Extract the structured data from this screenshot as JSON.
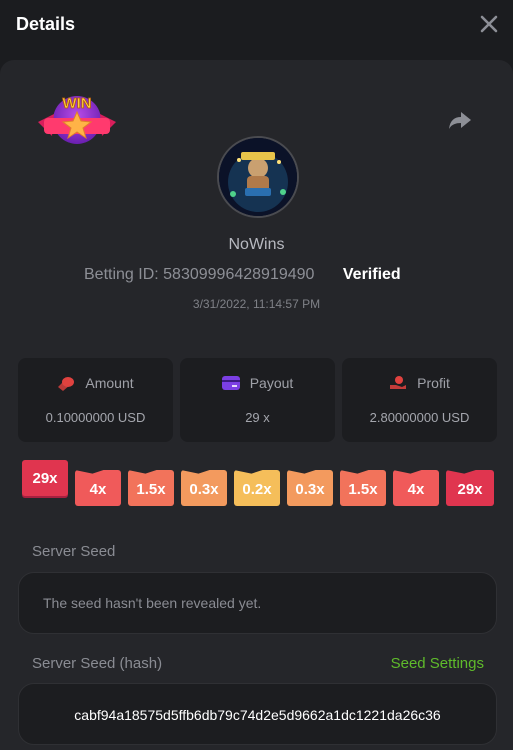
{
  "header": {
    "title": "Details"
  },
  "player": {
    "name": "NoWins"
  },
  "bet": {
    "id_label": "Betting ID:",
    "id": "58309996428919490",
    "verified": "Verified",
    "datetime": "3/31/2022, 11:14:57 PM"
  },
  "stats": [
    {
      "label": "Amount",
      "value": "0.10000000 USD",
      "icon": "coins-icon",
      "color": "#e0423f"
    },
    {
      "label": "Payout",
      "value": "29 x",
      "icon": "card-icon",
      "color": "#7b3fe4"
    },
    {
      "label": "Profit",
      "value": "2.80000000 USD",
      "icon": "hand-heart-icon",
      "color": "#e0423f"
    }
  ],
  "multipliers": [
    {
      "label": "29x",
      "color": "#e0354f",
      "selected": true
    },
    {
      "label": "4x",
      "color": "#f05a5a"
    },
    {
      "label": "1.5x",
      "color": "#f2735b"
    },
    {
      "label": "0.3x",
      "color": "#f39a5e"
    },
    {
      "label": "0.2x",
      "color": "#f5be5a"
    },
    {
      "label": "0.3x",
      "color": "#f39a5e"
    },
    {
      "label": "1.5x",
      "color": "#f2735b"
    },
    {
      "label": "4x",
      "color": "#f05a5a"
    },
    {
      "label": "29x",
      "color": "#e0354f"
    }
  ],
  "server_seed": {
    "label": "Server Seed",
    "value": "The seed hasn't been revealed yet."
  },
  "server_seed_hash": {
    "label": "Server Seed (hash)",
    "settings_label": "Seed Settings",
    "value": "cabf94a18575d5ffb6db79c74d2e5d9662a1dc1221da26c36"
  },
  "badge": {
    "text": "WIN"
  }
}
